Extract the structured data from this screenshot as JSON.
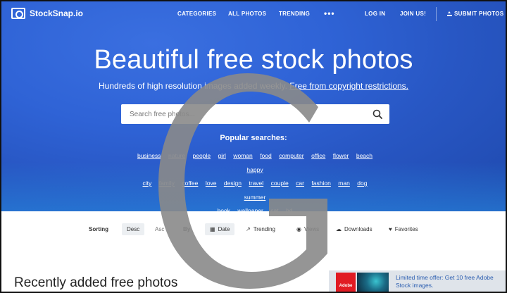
{
  "nav": {
    "logo": "StockSnap.io",
    "items": [
      "CATEGORIES",
      "ALL PHOTOS",
      "TRENDING"
    ],
    "more": "•••",
    "login": "LOG IN",
    "join": "JOIN US!",
    "submit": "SUBMIT PHOTOS"
  },
  "hero": {
    "title": "Beautiful free stock photos",
    "subtitle_text": "Hundreds of high resolution images added weekly.",
    "subtitle_link": "Free from copyright restrictions."
  },
  "search": {
    "placeholder": "Search free photos..."
  },
  "popular": {
    "title": "Popular searches:",
    "tags": [
      "business",
      "nature",
      "people",
      "girl",
      "woman",
      "food",
      "computer",
      "office",
      "flower",
      "beach",
      "happy",
      "city",
      "family",
      "coffee",
      "love",
      "design",
      "travel",
      "couple",
      "car",
      "fashion",
      "man",
      "dog",
      "summer",
      "book",
      "wallpaper",
      "cat",
      "hd"
    ]
  },
  "sorting": {
    "label": "Sorting",
    "desc": "Desc",
    "asc": "Asc",
    "by": "By",
    "options": [
      "Date",
      "Trending",
      "Views",
      "Downloads",
      "Favorites"
    ]
  },
  "recent_title": "Recently added free photos",
  "ad": {
    "brand": "Adobe",
    "text": "Limited time offer: Get 10 free Adobe Stock images."
  },
  "colors": {
    "hero_blue": "#2f63d6",
    "watermark_gray": "#8a8a8a",
    "adobe_red": "#e11b23"
  }
}
